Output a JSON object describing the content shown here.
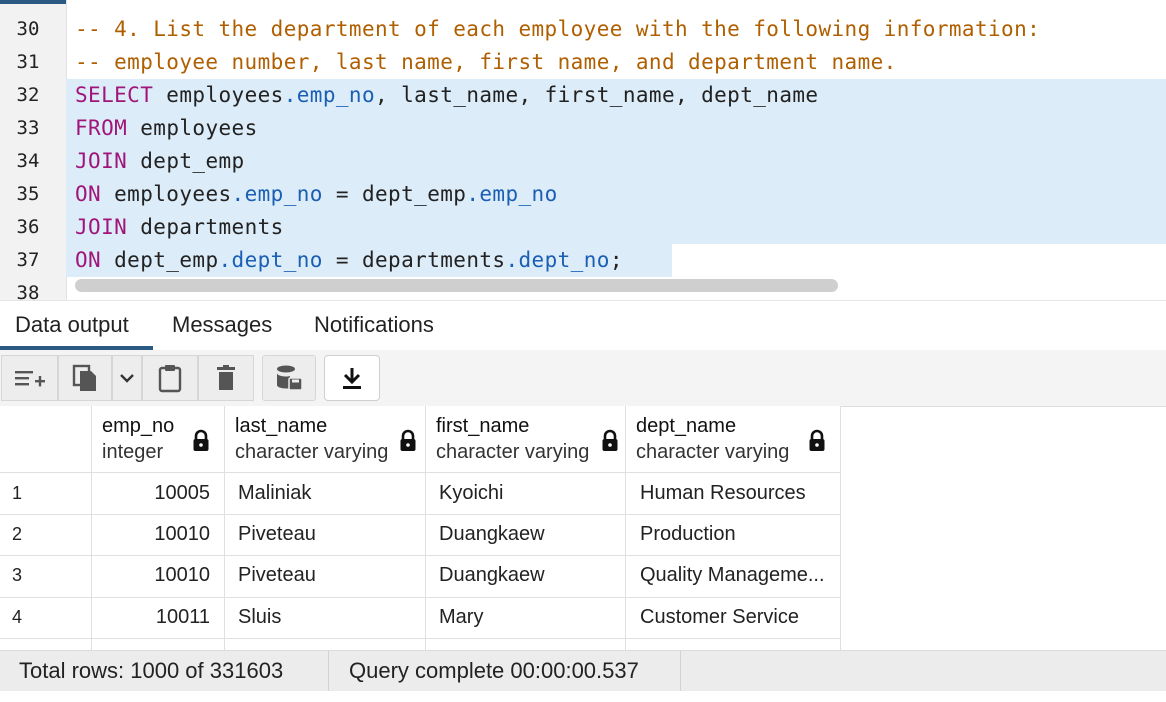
{
  "editor": {
    "lines": [
      {
        "num": "30",
        "parts": [
          {
            "t": "-- 4. List the department of each employee with the following information:",
            "c": "cmt"
          }
        ]
      },
      {
        "num": "31",
        "parts": [
          {
            "t": "-- employee number, last name, first name, and department name.",
            "c": "cmt"
          }
        ]
      },
      {
        "num": "32",
        "parts": [
          {
            "t": "SELECT",
            "c": "kw"
          },
          {
            "t": " employees",
            "c": ""
          },
          {
            "t": ".emp_no",
            "c": "prop"
          },
          {
            "t": ", last_name, first_name, dept_name",
            "c": ""
          }
        ]
      },
      {
        "num": "33",
        "parts": [
          {
            "t": "FROM",
            "c": "kw"
          },
          {
            "t": " employees",
            "c": ""
          }
        ]
      },
      {
        "num": "34",
        "parts": [
          {
            "t": "JOIN",
            "c": "kw"
          },
          {
            "t": " dept_emp",
            "c": ""
          }
        ]
      },
      {
        "num": "35",
        "parts": [
          {
            "t": "ON",
            "c": "kw"
          },
          {
            "t": " employees",
            "c": ""
          },
          {
            "t": ".emp_no",
            "c": "prop"
          },
          {
            "t": " = dept_emp",
            "c": ""
          },
          {
            "t": ".emp_no",
            "c": "prop"
          }
        ]
      },
      {
        "num": "36",
        "parts": [
          {
            "t": "JOIN",
            "c": "kw"
          },
          {
            "t": " departments",
            "c": ""
          }
        ]
      },
      {
        "num": "37",
        "parts": [
          {
            "t": "ON",
            "c": "kw"
          },
          {
            "t": " dept_emp",
            "c": ""
          },
          {
            "t": ".dept_no",
            "c": "prop"
          },
          {
            "t": " = departments",
            "c": ""
          },
          {
            "t": ".dept_no",
            "c": "prop"
          },
          {
            "t": ";",
            "c": ""
          }
        ]
      },
      {
        "num": "38",
        "parts": []
      }
    ]
  },
  "tabs": {
    "data_output": "Data output",
    "messages": "Messages",
    "notifications": "Notifications"
  },
  "toolbar": {
    "icons": [
      "add-row-icon",
      "copy-icon",
      "chevron-down-icon",
      "paste-icon",
      "delete-icon",
      "save-data-icon",
      "download-icon"
    ]
  },
  "grid": {
    "columns": [
      {
        "name": "emp_no",
        "type": "integer"
      },
      {
        "name": "last_name",
        "type": "character varying"
      },
      {
        "name": "first_name",
        "type": "character varying"
      },
      {
        "name": "dept_name",
        "type": "character varying"
      }
    ],
    "rows": [
      {
        "n": "1",
        "emp_no": "10005",
        "last_name": "Maliniak",
        "first_name": "Kyoichi",
        "dept_name": "Human Resources"
      },
      {
        "n": "2",
        "emp_no": "10010",
        "last_name": "Piveteau",
        "first_name": "Duangkaew",
        "dept_name": "Production"
      },
      {
        "n": "3",
        "emp_no": "10010",
        "last_name": "Piveteau",
        "first_name": "Duangkaew",
        "dept_name": "Quality Manageme..."
      },
      {
        "n": "4",
        "emp_no": "10011",
        "last_name": "Sluis",
        "first_name": "Mary",
        "dept_name": "Customer Service"
      }
    ]
  },
  "status": {
    "total_rows": "Total rows: 1000 of 331603",
    "query_complete": "Query complete 00:00:00.537"
  },
  "colors": {
    "accent": "#2a5a82",
    "selection": "#dcecf8",
    "comment": "#b05f00",
    "keyword": "#a0157a",
    "property": "#1a5fb4"
  }
}
